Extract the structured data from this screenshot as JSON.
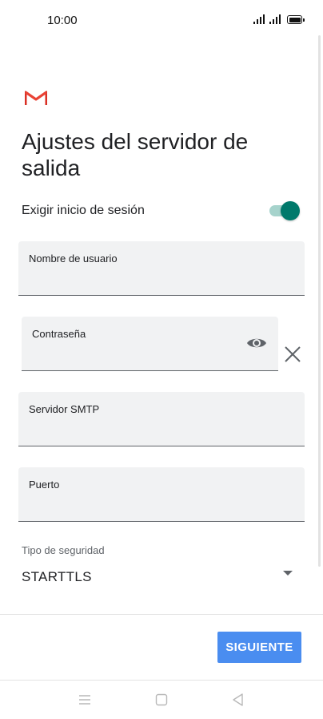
{
  "status_bar": {
    "time": "10:00",
    "icons": [
      "signal-icon",
      "signal-icon",
      "battery-icon"
    ]
  },
  "app": {
    "logo": "gmail-logo",
    "title": "Ajustes del servidor de salida"
  },
  "require_login": {
    "label": "Exigir inicio de sesión",
    "enabled": true
  },
  "fields": {
    "username": {
      "label": "Nombre de usuario",
      "value": ""
    },
    "password": {
      "label": "Contraseña",
      "value": ""
    },
    "smtp_server": {
      "label": "Servidor SMTP",
      "value": ""
    },
    "port": {
      "label": "Puerto",
      "value": ""
    }
  },
  "security": {
    "label": "Tipo de seguridad",
    "selected": "STARTTLS"
  },
  "actions": {
    "next_label": "SIGUIENTE"
  },
  "nav_bar": {
    "icons": [
      "menu-icon",
      "home-icon",
      "back-icon"
    ]
  },
  "colors": {
    "accent": "#4a8df0",
    "toggle_on": "#00796b",
    "toggle_track": "#a6d3cc",
    "field_bg": "#f1f2f3",
    "gmail_red": "#d93025"
  }
}
